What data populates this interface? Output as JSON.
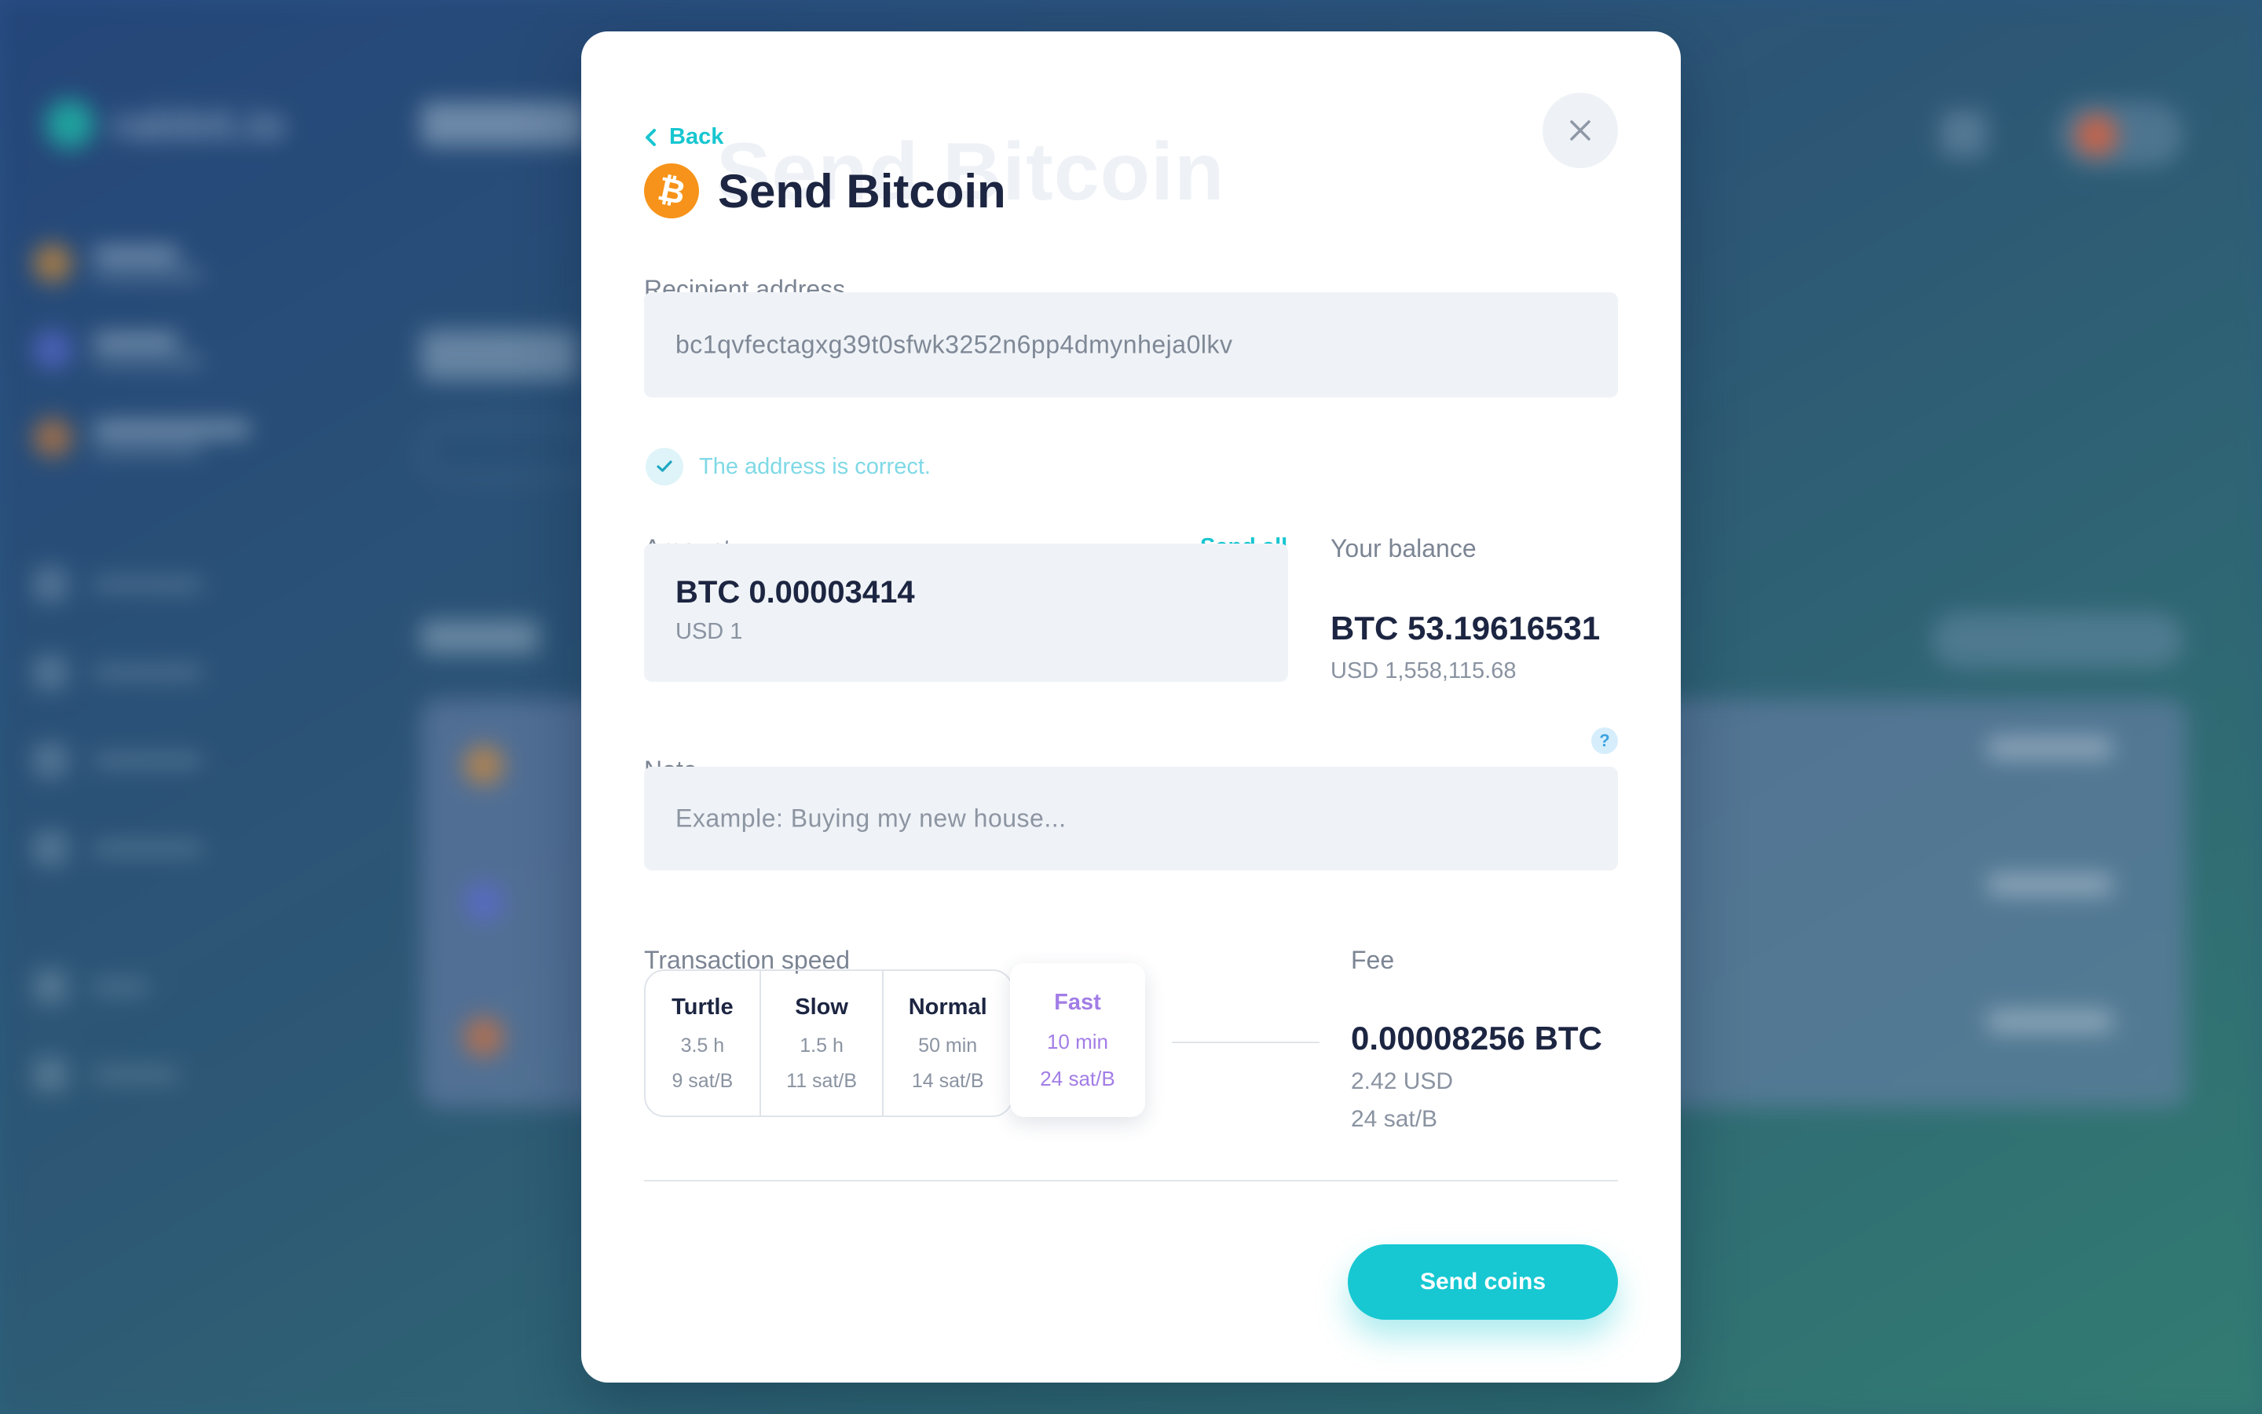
{
  "background_app": {
    "logo_text": "rabbit.io"
  },
  "modal": {
    "back_label": "Back",
    "title": "Send Bitcoin",
    "coin_symbol": "₿",
    "recipient": {
      "label": "Recipient address",
      "value": "bc1qvfectagxg39t0sfwk3252n6pp4dmynheja0lkv",
      "validation_message": "The address is correct."
    },
    "amount": {
      "label": "Amount",
      "send_all_label": "Send all",
      "value": "BTC 0.00003414",
      "usd_value": "USD 1"
    },
    "balance": {
      "label": "Your balance",
      "value": "BTC 53.19616531",
      "usd_value": "USD 1,558,115.68"
    },
    "note": {
      "label": "Note",
      "placeholder": "Example: Buying my new house...",
      "help_label": "?"
    },
    "speed": {
      "label": "Transaction speed",
      "options": [
        {
          "name": "Turtle",
          "time": "3.5 h",
          "rate": "9 sat/B"
        },
        {
          "name": "Slow",
          "time": "1.5 h",
          "rate": "11 sat/B"
        },
        {
          "name": "Normal",
          "time": "50 min",
          "rate": "14 sat/B"
        },
        {
          "name": "Fast",
          "time": "10 min",
          "rate": "24 sat/B"
        }
      ],
      "selected": "Fast"
    },
    "fee": {
      "label": "Fee",
      "value": "0.00008256 BTC",
      "usd_value": "2.42 USD",
      "rate": "24 sat/B"
    },
    "submit_label": "Send coins"
  },
  "colors": {
    "accent": "#17c8d2",
    "selected_speed": "#a27de6",
    "bitcoin": "#f7931a",
    "text_dark": "#1c2541"
  }
}
